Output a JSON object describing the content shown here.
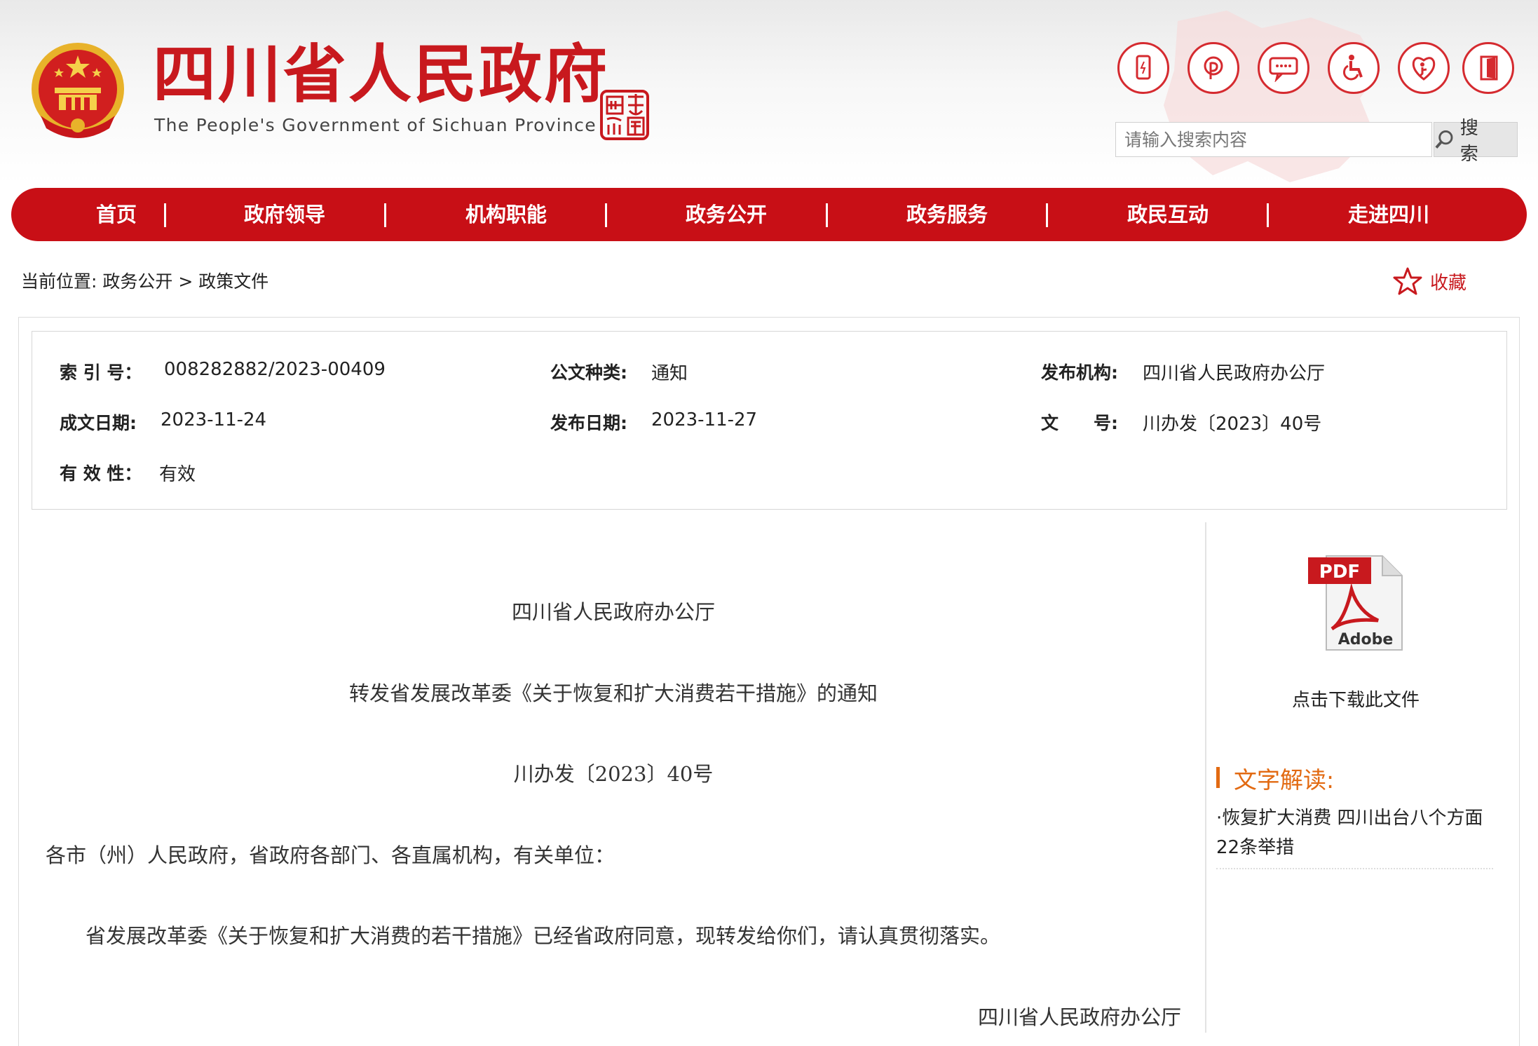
{
  "header": {
    "site_title": "四川省人民政府",
    "site_subtitle": "The People's Government of Sichuan Province",
    "seal_text": "中国四川",
    "tool_icons": [
      "mobile-icon",
      "weibo-icon",
      "wechat-message-icon",
      "accessibility-icon",
      "elderly-care-icon",
      "exit-door-icon"
    ],
    "search": {
      "placeholder": "请输入搜索内容",
      "button_label": "搜 索"
    }
  },
  "nav": {
    "items": [
      "首页",
      "政府领导",
      "机构职能",
      "政务公开",
      "政务服务",
      "政民互动",
      "走进四川"
    ]
  },
  "breadcrumb": {
    "prefix": "当前位置:",
    "path": [
      "政务公开",
      "政策文件"
    ],
    "separator": ">",
    "favorite_label": "收藏"
  },
  "meta": {
    "index_no": {
      "label": "索 引 号：",
      "value": "008282882/2023-00409"
    },
    "doc_type": {
      "label": "公文种类:",
      "value": "通知"
    },
    "publisher": {
      "label": "发布机构:",
      "value": "四川省人民政府办公厅"
    },
    "written_date": {
      "label": "成文日期:",
      "value": "2023-11-24"
    },
    "publish_date": {
      "label": "发布日期:",
      "value": "2023-11-27"
    },
    "doc_no": {
      "label_a": "文",
      "label_b": "号:",
      "value": "川办发〔2023〕40号"
    },
    "validity": {
      "label": "有 效 性：",
      "value": "有效"
    }
  },
  "document": {
    "issuer": "四川省人民政府办公厅",
    "title": "转发省发展改革委《关于恢复和扩大消费若干措施》的通知",
    "doc_number": "川办发〔2023〕40号",
    "salutation": "各市（州）人民政府，省政府各部门、各直属机构，有关单位：",
    "body": "省发展改革委《关于恢复和扩大消费的若干措施》已经省政府同意，现转发给你们，请认真贯彻落实。",
    "signature": "四川省人民政府办公厅"
  },
  "sidebar": {
    "pdf_badge": "PDF",
    "pdf_brand": "Adobe",
    "download_label": "点击下载此文件",
    "interpretation_title": "文字解读:",
    "interpretation_link": "·恢复扩大消费 四川出台八个方面22条举措"
  },
  "colors": {
    "brand_red": "#c80f16",
    "accent_orange": "#e26a12"
  }
}
